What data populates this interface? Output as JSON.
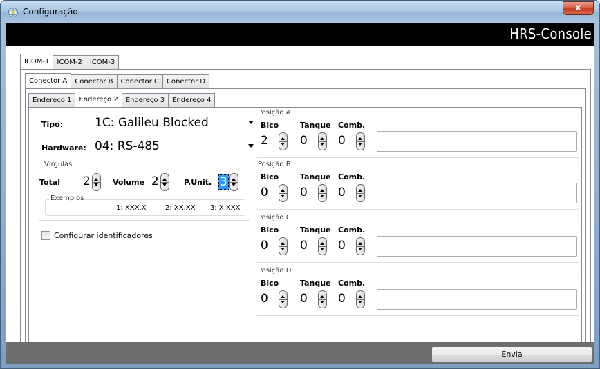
{
  "window": {
    "title": "Configuração",
    "close_label": "x",
    "brand": "HRS-Console"
  },
  "icom_tabs": [
    "ICOM-1",
    "ICOM-2",
    "ICOM-3"
  ],
  "conector_tabs": [
    "Conector A",
    "Conector B",
    "Conector C",
    "Conector D"
  ],
  "endereco_tabs": [
    "Endereço 1",
    "Endereço 2",
    "Endereço 3",
    "Endereço 4"
  ],
  "active": {
    "icom": "ICOM-1",
    "conector": "Conector A",
    "endereco": "Endereço 2"
  },
  "form": {
    "tipo_label": "Tipo:",
    "tipo_value": "1C: Galileu Blocked",
    "hardware_label": "Hardware:",
    "hardware_value": "04: RS-485",
    "virgulas": {
      "caption": "Vírgulas",
      "total_label": "Total",
      "total_value": "2",
      "volume_label": "Volume",
      "volume_value": "2",
      "punit_label": "P.Unit.",
      "punit_value": "3"
    },
    "exemplos": {
      "caption": "Exemplos",
      "ex1": "1: XXX.X",
      "ex2": "2: XX.XX",
      "ex3": "3: X.XXX"
    },
    "configurar_label": "Configurar identificadores",
    "configurar_checked": false
  },
  "posicoes": [
    {
      "caption": "Posição A",
      "bico_label": "Bico",
      "tanque_label": "Tanque",
      "comb_label": "Comb.",
      "bico": "2",
      "tanque": "0",
      "comb": "0",
      "text": ""
    },
    {
      "caption": "Posição B",
      "bico_label": "Bico",
      "tanque_label": "Tanque",
      "comb_label": "Comb.",
      "bico": "0",
      "tanque": "0",
      "comb": "0",
      "text": ""
    },
    {
      "caption": "Posição C",
      "bico_label": "Bico",
      "tanque_label": "Tanque",
      "comb_label": "Comb.",
      "bico": "0",
      "tanque": "0",
      "comb": "0",
      "text": ""
    },
    {
      "caption": "Posição D",
      "bico_label": "Bico",
      "tanque_label": "Tanque",
      "comb_label": "Comb.",
      "bico": "0",
      "tanque": "0",
      "comb": "0",
      "text": ""
    }
  ],
  "footer": {
    "envia_label": "Envia"
  },
  "colors": {
    "banner_bg": "#000000",
    "client_bg": "#6d6d6d",
    "selection": "#3399ff"
  }
}
